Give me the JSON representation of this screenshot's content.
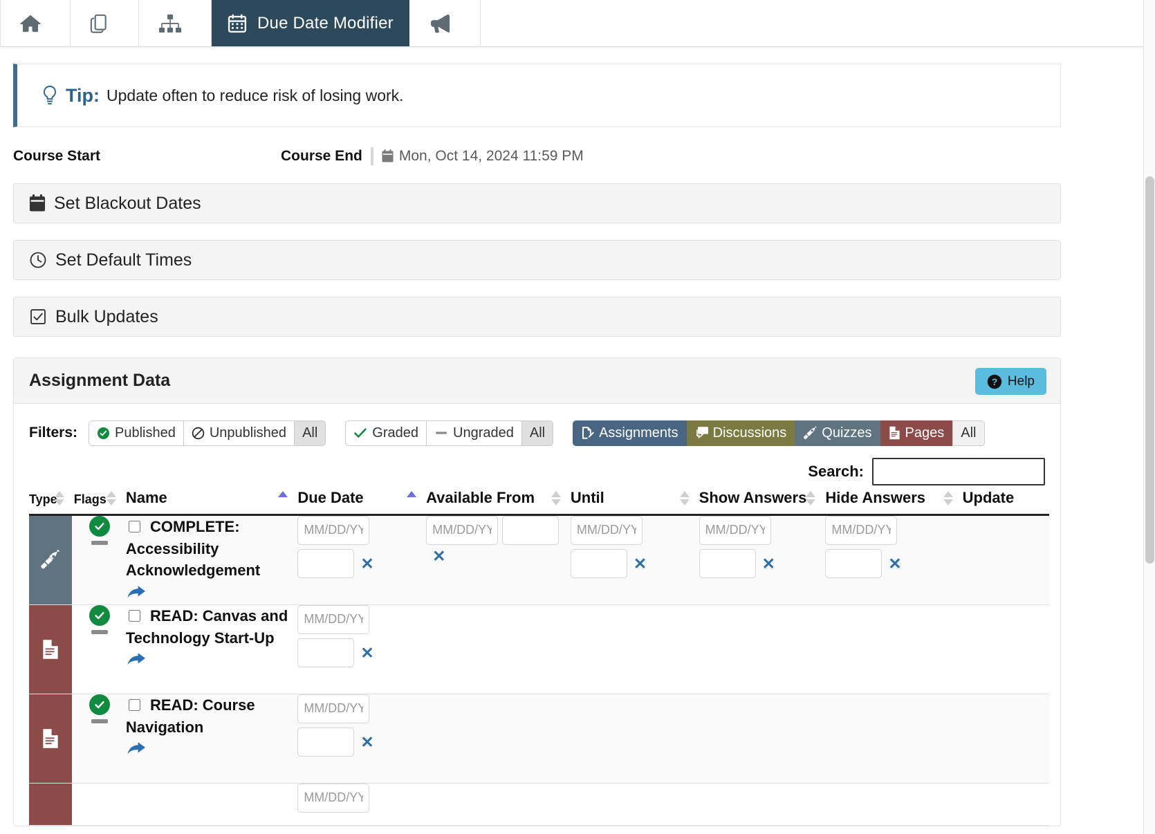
{
  "topnav": {
    "items": [
      {
        "name": "home",
        "icon": "home-icon",
        "label": "",
        "active": false
      },
      {
        "name": "copy",
        "icon": "pages-copy-icon",
        "label": "",
        "active": false
      },
      {
        "name": "sitemap",
        "icon": "sitemap-icon",
        "label": "",
        "active": false
      },
      {
        "name": "due-date-modifier",
        "icon": "calendar-icon",
        "label": "Due Date Modifier",
        "active": true
      },
      {
        "name": "announcements",
        "icon": "megaphone-icon",
        "label": "",
        "active": false
      }
    ],
    "active_label": "Due Date Modifier"
  },
  "tip": {
    "icon": "lightbulb-icon",
    "label": "Tip:",
    "text": "Update often to reduce risk of losing work."
  },
  "course": {
    "start_label": "Course Start",
    "start_value": "",
    "end_label": "Course End",
    "end_icon": "calendar-icon",
    "end_value": "Mon, Oct 14, 2024 11:59 PM"
  },
  "sections": [
    {
      "icon": "calendar-icon",
      "label": "Set Blackout Dates"
    },
    {
      "icon": "clock-icon",
      "label": "Set Default Times"
    },
    {
      "icon": "checkbox-icon",
      "label": "Bulk Updates"
    }
  ],
  "panel": {
    "title": "Assignment Data",
    "help_label": "Help",
    "help_icon": "question-circle-icon",
    "help_color": "#5bbcdd"
  },
  "filters": {
    "label": "Filters:",
    "groups": [
      {
        "name": "publish-state",
        "type": "plain",
        "buttons": [
          {
            "label": "Published",
            "icon": "check-circle-icon",
            "icon_color": "#0f8a3e",
            "selected": false
          },
          {
            "label": "Unpublished",
            "icon": "no-entry-icon",
            "icon_color": "#222222",
            "selected": false
          },
          {
            "label": "All",
            "icon": "",
            "icon_color": "",
            "selected": true
          }
        ]
      },
      {
        "name": "grading-state",
        "type": "plain",
        "buttons": [
          {
            "label": "Graded",
            "icon": "check-icon",
            "icon_color": "#0f8a3e",
            "selected": false
          },
          {
            "label": "Ungraded",
            "icon": "dash-icon",
            "icon_color": "#8b8b8b",
            "selected": false
          },
          {
            "label": "All",
            "icon": "",
            "icon_color": "",
            "selected": true
          }
        ]
      },
      {
        "name": "content-type",
        "type": "colored",
        "buttons": [
          {
            "label": "Assignments",
            "icon": "assignment-icon",
            "bg": "#486581",
            "selected": false
          },
          {
            "label": "Discussions",
            "icon": "discussion-icon",
            "bg": "#7a7a42",
            "selected": false
          },
          {
            "label": "Quizzes",
            "icon": "rocket-icon",
            "bg": "#5f7480",
            "selected": false
          },
          {
            "label": "Pages",
            "icon": "page-icon",
            "bg": "#8a4b49",
            "selected": false
          },
          {
            "label": "All",
            "icon": "",
            "bg": "#f1f1f1",
            "selected": true
          }
        ]
      }
    ]
  },
  "search": {
    "label": "Search:",
    "value": "",
    "placeholder": ""
  },
  "table": {
    "columns": [
      {
        "key": "type",
        "label": "Type",
        "sortable": true,
        "sort": "none"
      },
      {
        "key": "flags",
        "label": "Flags",
        "sortable": true,
        "sort": "none"
      },
      {
        "key": "name",
        "label": "Name",
        "sortable": true,
        "sort": "asc"
      },
      {
        "key": "due",
        "label": "Due Date",
        "sortable": true,
        "sort": "asc"
      },
      {
        "key": "avail",
        "label": "Available From",
        "sortable": true,
        "sort": "none"
      },
      {
        "key": "until",
        "label": "Until",
        "sortable": true,
        "sort": "none"
      },
      {
        "key": "show",
        "label": "Show Answers",
        "sortable": true,
        "sort": "none"
      },
      {
        "key": "hide",
        "label": "Hide Answers",
        "sortable": true,
        "sort": "none"
      },
      {
        "key": "upd",
        "label": "Update",
        "sortable": false,
        "sort": "none"
      }
    ],
    "date_placeholder": "MM/DD/YYYY",
    "time_placeholder": "",
    "clear_symbol": "✕",
    "rows": [
      {
        "type": "quiz",
        "type_icon": "rocket-icon",
        "type_color": "#5f7480",
        "published": true,
        "published_icon": "check-circle-icon",
        "ungraded_icon": "dash-icon",
        "checkbox_checked": false,
        "name": "COMPLETE: Accessibility Acknowledgement",
        "share_icon": "share-arrow-icon",
        "due": {
          "date": "",
          "time": "",
          "has_clear": true,
          "show": true
        },
        "available_from": {
          "date": "",
          "time": "",
          "extra": "",
          "has_clear": true,
          "show": true
        },
        "until": {
          "date": "",
          "time": "",
          "has_clear": true,
          "show": true
        },
        "show_answers": {
          "date": "",
          "time": "",
          "has_clear": true,
          "show": true
        },
        "hide_answers": {
          "date": "",
          "time": "",
          "has_clear": true,
          "show": true
        }
      },
      {
        "type": "page",
        "type_icon": "page-icon",
        "type_color": "#8a4b49",
        "published": true,
        "published_icon": "check-circle-icon",
        "ungraded_icon": "dash-icon",
        "checkbox_checked": false,
        "name": "READ: Canvas and Technology Start-Up",
        "share_icon": "share-arrow-icon",
        "due": {
          "date": "",
          "time": "",
          "has_clear": true,
          "show": true
        },
        "available_from": {
          "date": "",
          "time": "",
          "extra": "",
          "has_clear": false,
          "show": false
        },
        "until": {
          "date": "",
          "time": "",
          "has_clear": false,
          "show": false
        },
        "show_answers": {
          "date": "",
          "time": "",
          "has_clear": false,
          "show": false
        },
        "hide_answers": {
          "date": "",
          "time": "",
          "has_clear": false,
          "show": false
        }
      },
      {
        "type": "page",
        "type_icon": "page-icon",
        "type_color": "#8a4b49",
        "published": true,
        "published_icon": "check-circle-icon",
        "ungraded_icon": "dash-icon",
        "checkbox_checked": false,
        "name": "READ: Course Navigation",
        "share_icon": "share-arrow-icon",
        "due": {
          "date": "",
          "time": "",
          "has_clear": true,
          "show": true
        },
        "available_from": {
          "date": "",
          "time": "",
          "extra": "",
          "has_clear": false,
          "show": false
        },
        "until": {
          "date": "",
          "time": "",
          "has_clear": false,
          "show": false
        },
        "show_answers": {
          "date": "",
          "time": "",
          "has_clear": false,
          "show": false
        },
        "hide_answers": {
          "date": "",
          "time": "",
          "has_clear": false,
          "show": false
        }
      }
    ]
  }
}
